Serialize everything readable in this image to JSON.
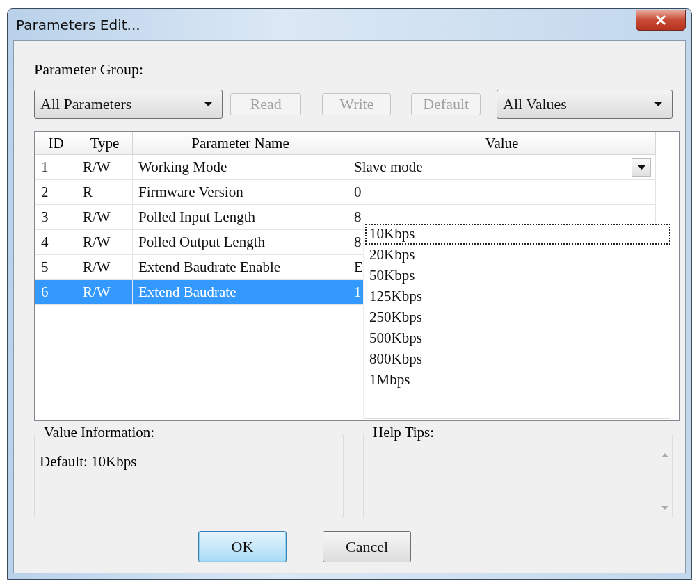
{
  "window": {
    "title": "Parameters Edit..."
  },
  "parameter_group": {
    "label": "Parameter Group:"
  },
  "toolbar": [
    {
      "kind": "combo",
      "value": "All Parameters"
    },
    {
      "kind": "button",
      "label": "Read",
      "disabled": true
    },
    {
      "kind": "button",
      "label": "Write",
      "disabled": true
    },
    {
      "kind": "button",
      "label": "Default",
      "disabled": true
    },
    {
      "kind": "combo",
      "value": "All Values"
    }
  ],
  "table": {
    "columns": [
      "ID",
      "Type",
      "Parameter Name",
      "Value"
    ],
    "rows": [
      {
        "id": "1",
        "type": "R/W",
        "name": "Working Mode",
        "value": "Slave mode",
        "kind": "combo",
        "selected": false
      },
      {
        "id": "2",
        "type": "R",
        "name": "Firmware Version",
        "value": "0",
        "kind": "text",
        "selected": false
      },
      {
        "id": "3",
        "type": "R/W",
        "name": "Polled Input Length",
        "value": "8",
        "kind": "text",
        "selected": false
      },
      {
        "id": "4",
        "type": "R/W",
        "name": "Polled Output Length",
        "value": "8",
        "kind": "text",
        "selected": false
      },
      {
        "id": "5",
        "type": "R/W",
        "name": "Extend Baudrate Enable",
        "value": "E",
        "kind": "text",
        "selected": false
      },
      {
        "id": "6",
        "type": "R/W",
        "name": "Extend Baudrate",
        "value": "1",
        "kind": "text",
        "selected": true
      }
    ]
  },
  "dropdown": {
    "items": [
      {
        "label": "10Kbps",
        "selected": true
      },
      {
        "label": "20Kbps",
        "selected": false
      },
      {
        "label": "50Kbps",
        "selected": false
      },
      {
        "label": "125Kbps",
        "selected": false
      },
      {
        "label": "250Kbps",
        "selected": false
      },
      {
        "label": "500Kbps",
        "selected": false
      },
      {
        "label": "800Kbps",
        "selected": false
      },
      {
        "label": "1Mbps",
        "selected": false
      }
    ]
  },
  "value_information": {
    "title": "Value Information:",
    "text": "Default:  10Kbps"
  },
  "help_tips": {
    "title": "Help Tips:"
  },
  "buttons": [
    {
      "label": "OK",
      "focused": true
    },
    {
      "label": "Cancel",
      "focused": false
    }
  ]
}
